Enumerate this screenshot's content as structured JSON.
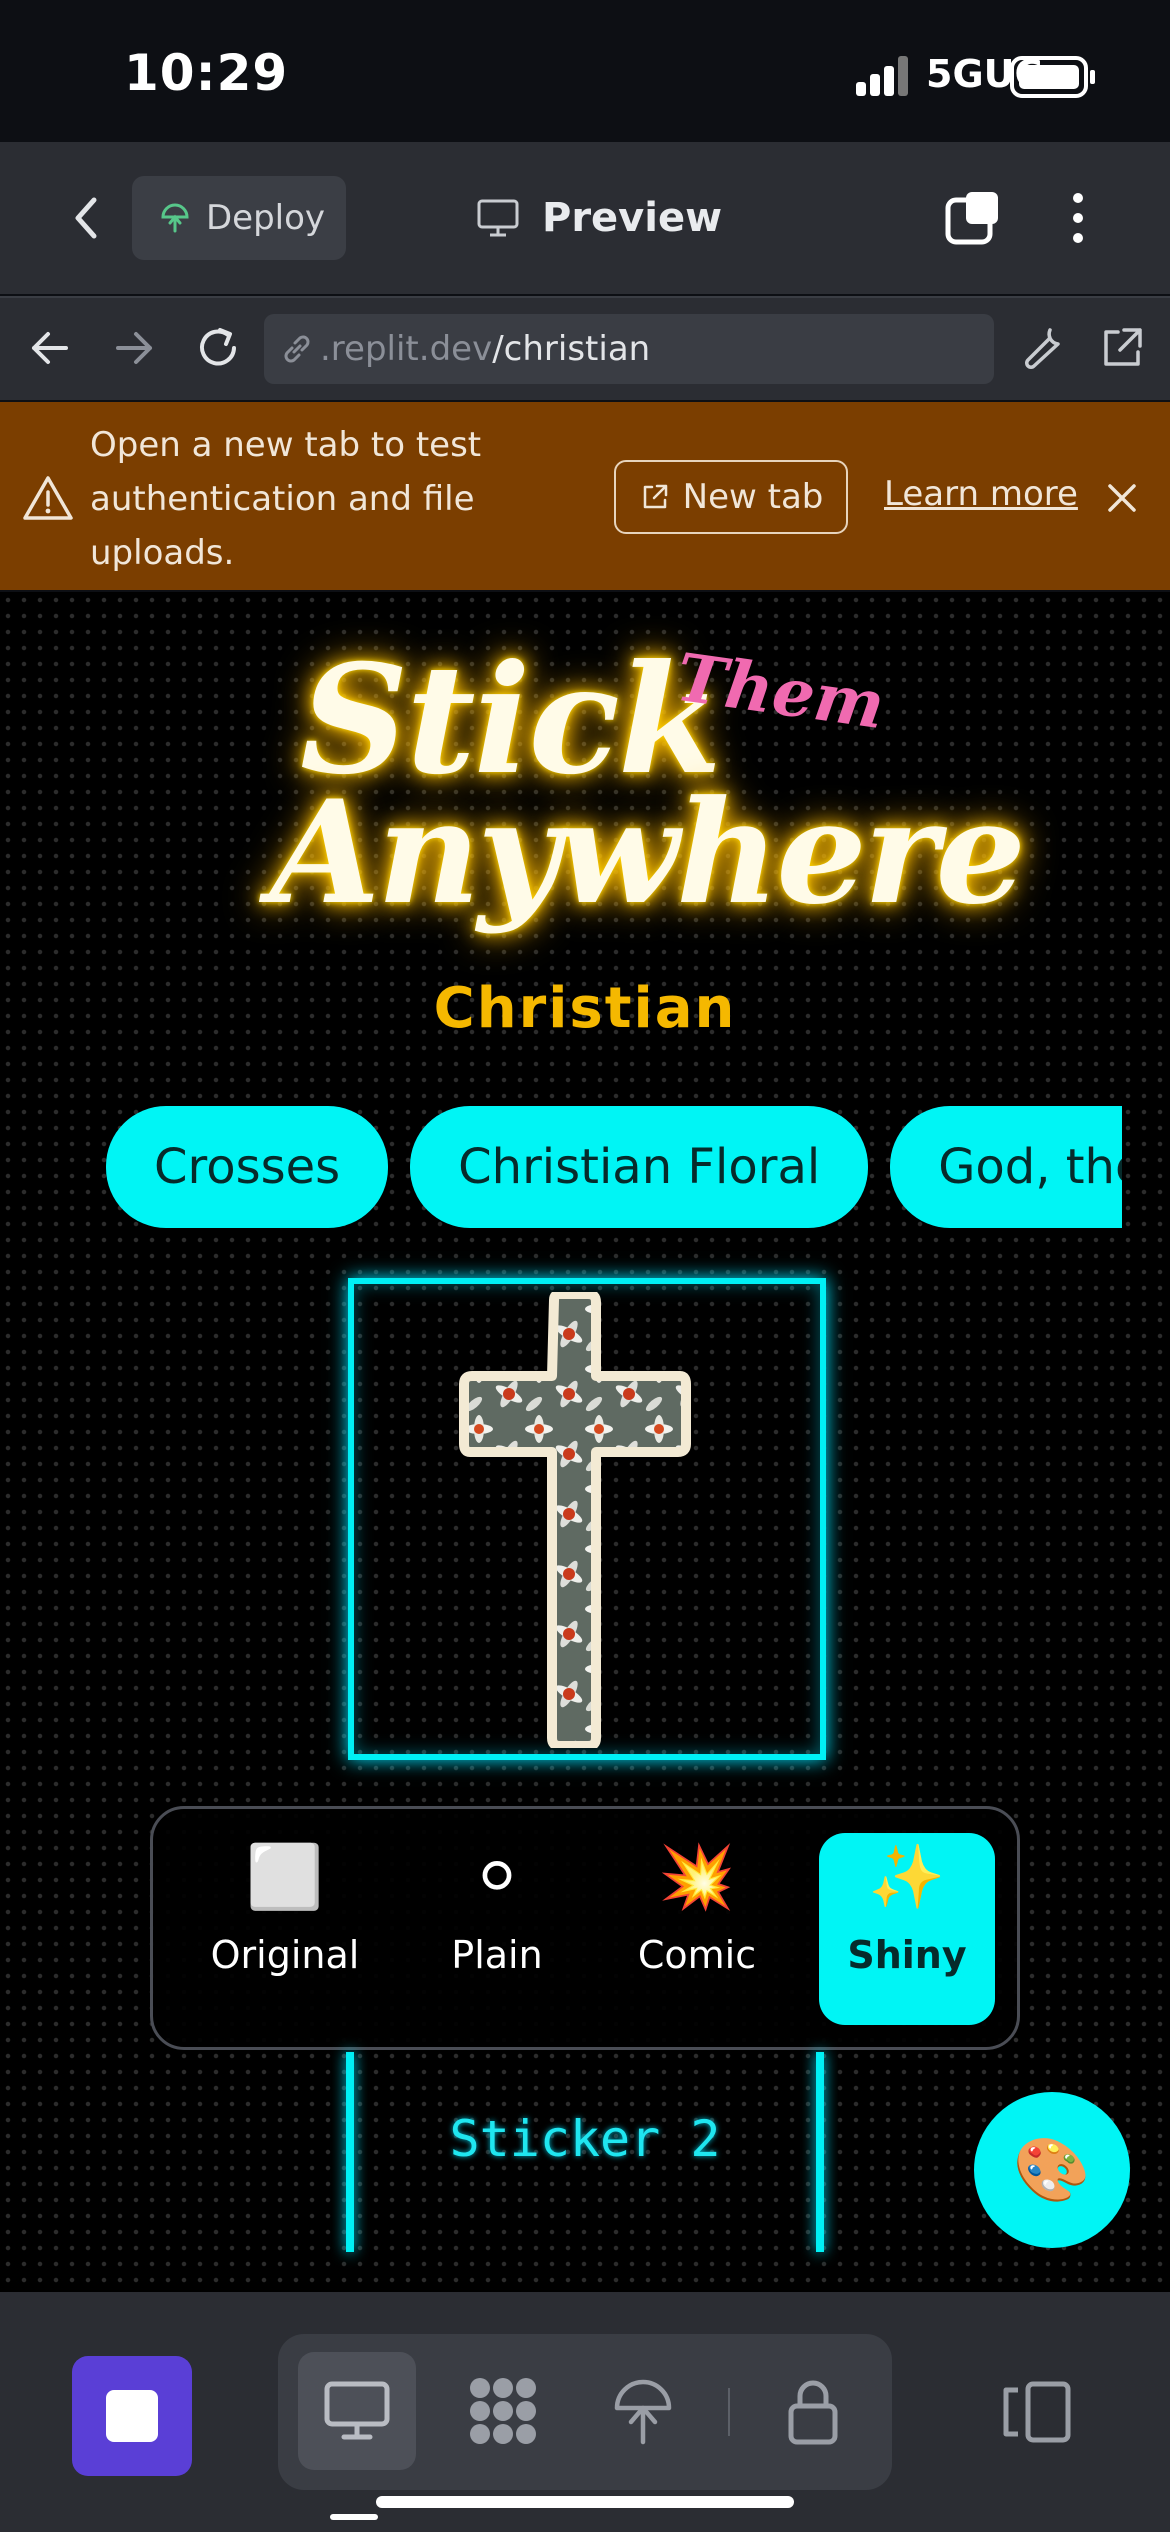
{
  "status_bar": {
    "time": "10:29",
    "network": "5GUC"
  },
  "header": {
    "deploy_label": "Deploy",
    "preview_label": "Preview"
  },
  "url_bar": {
    "host": ".replit.dev",
    "path": "/christian"
  },
  "banner": {
    "message": "Open a new tab to test authentication and file uploads.",
    "new_tab_label": "New tab",
    "learn_more_label": "Learn more"
  },
  "app": {
    "title_line1": "Stick",
    "title_accent": "Them",
    "title_line2": "Anywhere",
    "subtitle": "Christian",
    "categories": [
      "Crosses",
      "Christian Floral",
      "God, the"
    ],
    "style_options": [
      {
        "emoji": "⬜",
        "label": "Original",
        "active": false
      },
      {
        "emoji": "⚪",
        "label": "Plain",
        "active": false
      },
      {
        "emoji": "💥",
        "label": "Comic",
        "active": false
      },
      {
        "emoji": "✨",
        "label": "Shiny",
        "active": true
      }
    ],
    "next_sticker_label": "Sticker 2",
    "palette_emoji": "🎨"
  },
  "colors": {
    "accent_cyan": "#00f5f5",
    "neon_gold": "#ffc400",
    "accent_pink": "#f06ab0",
    "banner_bg": "#7b3e00",
    "stop_button": "#5a3fd6"
  },
  "icons": {
    "header": [
      "chevron-left-icon",
      "deploy-icon",
      "monitor-icon",
      "tabs-icon",
      "more-vertical-icon"
    ],
    "url_bar": [
      "arrow-left-icon",
      "arrow-right-icon",
      "reload-icon",
      "link-icon",
      "wrench-icon",
      "external-link-icon"
    ],
    "toolbar": [
      "stop-icon",
      "monitor-icon",
      "apps-grid-icon",
      "deploy-icon",
      "lock-icon",
      "panel-toggle-icon"
    ]
  }
}
